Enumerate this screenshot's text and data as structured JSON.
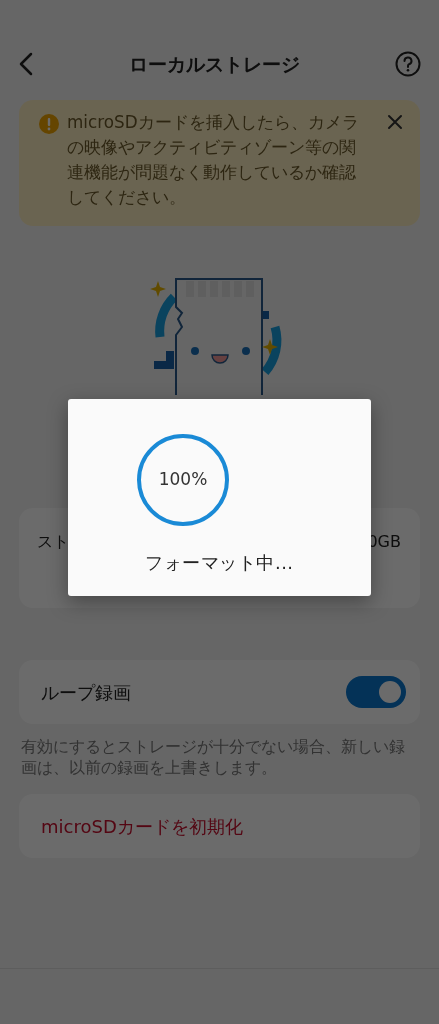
{
  "header": {
    "title": "ローカルストレージ"
  },
  "notice": {
    "text": "microSDカードを挿入したら、カメラの映像やアクティビティゾーン等の関連機能が問題なく動作しているか確認してください。"
  },
  "storage": {
    "label": "スト",
    "value": "0GB"
  },
  "loop_recording": {
    "label": "ループ録画",
    "on": true,
    "description": "有効にするとストレージが十分でない場合、新しい録画は、以前の録画を上書きします。"
  },
  "format_button": {
    "label": "microSDカードを初期化"
  },
  "dialog": {
    "progress": "100%",
    "level": 1,
    "message": "フォーマット中..."
  }
}
